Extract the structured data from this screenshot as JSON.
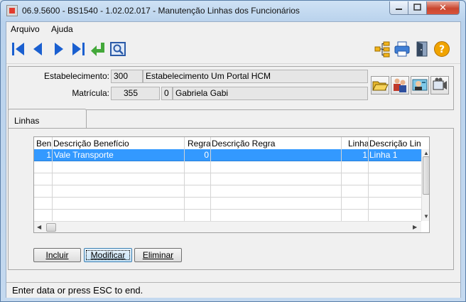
{
  "window": {
    "title": "06.9.5600 - BS1540 - 1.02.02.017 - Manutenção Linhas dos Funcionários",
    "close_glyph": "✕"
  },
  "menu": {
    "items": [
      {
        "label": "Arquivo"
      },
      {
        "label": "Ajuda"
      }
    ]
  },
  "toolbar": {
    "buttons": [
      "first-record-icon",
      "previous-record-icon",
      "next-record-icon",
      "last-record-icon",
      "return-icon",
      "search-icon",
      "tree-icon",
      "print-icon",
      "exit-door-icon",
      "help-icon"
    ]
  },
  "header": {
    "estabelecimento_label": "Estabelecimento:",
    "estabelecimento_code": "300",
    "estabelecimento_name": "Estabelecimento Um Portal HCM",
    "matricula_label": "Matrícula:",
    "matricula_value": "355",
    "matricula_digit": "0",
    "employee_name": "Gabriela Gabi"
  },
  "tabs": [
    {
      "label": "Linhas",
      "active": true
    }
  ],
  "grid": {
    "columns": [
      "Ben",
      "Descrição Benefício",
      "Regra",
      "Descrição Regra",
      "Linha",
      "Descrição Linh"
    ],
    "rows": [
      {
        "ben": "1",
        "descricao_beneficio": "Vale Transporte",
        "regra": "0",
        "descricao_regra": "",
        "linha": "1",
        "descricao_linha": "Linha 1",
        "selected": true
      }
    ]
  },
  "actions": {
    "incluir": "Incluir",
    "modificar": "Modificar",
    "eliminar": "Eliminar"
  },
  "status": {
    "message": "Enter data or press ESC to end."
  },
  "colors": {
    "selection": "#3399ff",
    "title_bar": "#c4d9ef",
    "close_button": "#c9462f"
  }
}
